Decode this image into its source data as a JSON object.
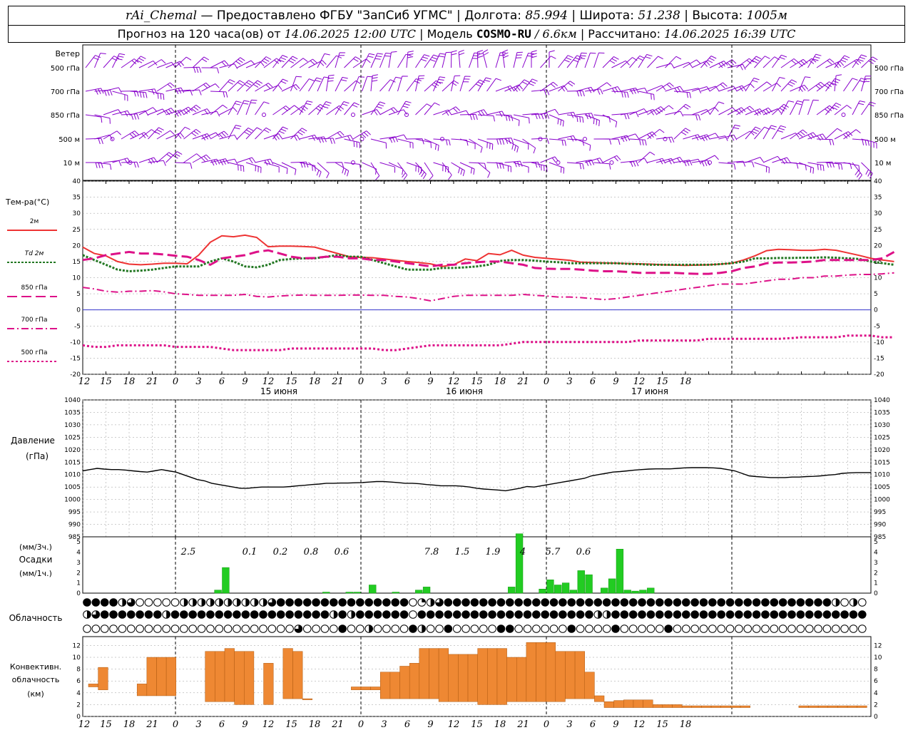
{
  "header": {
    "station": "rAi_Chemal",
    "provider": "Предоставлено ФГБУ \"ЗапСиб УГМС\"",
    "lon_label": "Долгота:",
    "lon": "85.994",
    "lat_label": "Широта:",
    "lat": "51.238",
    "alt_label": "Высота:",
    "alt": "1005м",
    "forecast_prefix": "Прогноз на 120 часа(ов) от",
    "forecast_start": "14.06.2025 12:00 UTC",
    "model_label": "Модель",
    "model_name": "COSMO-RU",
    "model_res": "/ 6.6км",
    "calc_label": "Рассчитано:",
    "calc_time": "14.06.2025 16:39 UTC"
  },
  "colors": {
    "wind": "#8800cc",
    "t2m": "#ee3333",
    "td2m": "#227722",
    "t850": "#dd1188",
    "t700": "#dd1188",
    "t500": "#dd1188",
    "zero_line": "#3333cc",
    "pressure": "#000000",
    "precip": "#22cc22",
    "convective": "#ee8833",
    "grid": "#999999"
  },
  "chart_data": [
    {
      "type": "wind-barbs",
      "title": "Ветер",
      "levels": [
        "500 гПа",
        "700 гПа",
        "850 гПа",
        "500 м",
        "10 м"
      ]
    },
    {
      "type": "line",
      "title": "Тем-ра(°C)",
      "ylim": [
        -20,
        40
      ],
      "yticks": [
        -20,
        -15,
        -10,
        -5,
        0,
        5,
        10,
        15,
        20,
        25,
        30,
        35,
        40
      ],
      "x_tick_labels": [
        "12",
        "15",
        "18",
        "21",
        "0",
        "3",
        "6",
        "9",
        "12",
        "15",
        "18",
        "21",
        "0",
        "3",
        "6",
        "9",
        "12",
        "15",
        "18",
        "21",
        "0",
        "3",
        "6",
        "9",
        "12",
        "15",
        "18"
      ],
      "date_labels": [
        "15 июня",
        "16 июня",
        "17 июня"
      ],
      "series": [
        {
          "name": "2м",
          "values": [
            19.5,
            17.5,
            16.8,
            15,
            14.2,
            14,
            14.2,
            14.5,
            14.5,
            14.3,
            17,
            21,
            23,
            22.7,
            23.2,
            22.5,
            19.6,
            19.8,
            19.8,
            19.7,
            19.5,
            18.5,
            17.5,
            16.5,
            16.3,
            16.2,
            15.8,
            15.4,
            15,
            14.7,
            14.3,
            13.5,
            14,
            15.8,
            15.3,
            17.5,
            17.1,
            18.5,
            17,
            16.3,
            16,
            15.7,
            15.4,
            14.8,
            14.7,
            14.6,
            14.5,
            14.4,
            14.3,
            14.2,
            14,
            13.9,
            13.8,
            13.9,
            14,
            14.2,
            14.5,
            15.5,
            16.8,
            18.4,
            18.8,
            18.7,
            18.5,
            18.5,
            18.8,
            18.5,
            17.7,
            16.9,
            16,
            15.5,
            15
          ]
        },
        {
          "name": "Td 2м",
          "values": [
            17,
            15.5,
            14,
            12.5,
            12,
            12.2,
            12.5,
            13,
            13.5,
            13.5,
            13.5,
            15,
            16,
            15,
            13.5,
            13.2,
            14,
            15.5,
            15.8,
            16,
            16,
            16.5,
            17,
            16.5,
            16.5,
            15.5,
            14.5,
            13.5,
            12.5,
            12.5,
            12.5,
            13,
            13,
            13.2,
            13.5,
            14,
            15.2,
            15.5,
            15.5,
            15.3,
            15,
            14.8,
            14.5,
            14.5,
            14.5,
            14.5,
            14.5,
            14.3,
            14.2,
            14,
            14,
            14,
            14,
            14,
            14,
            14.2,
            14.5,
            15,
            16,
            16,
            16.1,
            16.1,
            16.2,
            16.2,
            16.3,
            16.2,
            16,
            15.8,
            15,
            14.5,
            14
          ]
        },
        {
          "name": "850 гПа",
          "values": [
            15.5,
            16,
            17,
            17.5,
            18,
            17.5,
            17.5,
            17.2,
            16.8,
            16.5,
            15.5,
            14,
            16,
            16.5,
            17,
            18,
            18.5,
            17.5,
            16.5,
            16,
            16.1,
            16.5,
            16.5,
            16,
            16,
            15.5,
            15.5,
            15,
            14.5,
            14,
            13.5,
            14,
            14,
            14.5,
            14.8,
            15,
            15,
            14.5,
            14,
            13,
            12.8,
            12.7,
            12.7,
            12.5,
            12.2,
            12,
            12,
            11.8,
            11.5,
            11.5,
            11.5,
            11.5,
            11.3,
            11.2,
            11.2,
            11.5,
            12,
            13,
            13.5,
            14.5,
            14.7,
            14.7,
            14.8,
            15,
            15.5,
            15.5,
            15.5,
            15.5,
            15.5,
            16,
            18
          ]
        },
        {
          "name": "700 гПа",
          "values": [
            7,
            6.5,
            5.8,
            5.5,
            5.8,
            5.8,
            6,
            5.6,
            5,
            4.8,
            4.5,
            4.5,
            4.5,
            4.5,
            4.8,
            4.2,
            4,
            4.3,
            4.5,
            4.6,
            4.5,
            4.5,
            4.5,
            4.6,
            4.6,
            4.5,
            4.5,
            4.2,
            4,
            3.5,
            2.8,
            3.5,
            4.2,
            4.5,
            4.5,
            4.5,
            4.5,
            4.5,
            4.8,
            4.5,
            4.3,
            4,
            4,
            3.8,
            3.5,
            3.2,
            3.5,
            4,
            4.5,
            5,
            5.5,
            6,
            6.5,
            7,
            7.5,
            8,
            8,
            8,
            8.5,
            9,
            9.5,
            9.5,
            10,
            10,
            10.5,
            10.5,
            10.8,
            11,
            11,
            11.2,
            11.5
          ]
        },
        {
          "name": "500 гПа",
          "values": [
            -11,
            -11.5,
            -11.5,
            -11,
            -11,
            -11,
            -11,
            -11,
            -11.5,
            -11.5,
            -11.5,
            -11.5,
            -12,
            -12.5,
            -12.5,
            -12.5,
            -12.5,
            -12.5,
            -12,
            -12,
            -12,
            -12,
            -12,
            -12,
            -12,
            -12,
            -12.5,
            -12.5,
            -12,
            -11.5,
            -11,
            -11,
            -11,
            -11,
            -11,
            -11,
            -11,
            -10.5,
            -10,
            -10,
            -10,
            -10,
            -10,
            -10,
            -10,
            -10,
            -10,
            -10,
            -9.5,
            -9.5,
            -9.5,
            -9.5,
            -9.5,
            -9.5,
            -9,
            -9,
            -9,
            -9,
            -9,
            -9,
            -9,
            -8.8,
            -8.5,
            -8.5,
            -8.5,
            -8.5,
            -8,
            -8,
            -8,
            -8.5,
            -8.5
          ]
        }
      ]
    },
    {
      "type": "line",
      "title": "Давление",
      "unit": "(гПа)",
      "ylim": [
        985,
        1040
      ],
      "yticks": [
        985,
        990,
        995,
        1000,
        1005,
        1010,
        1015,
        1020,
        1025,
        1030,
        1035,
        1040
      ],
      "series": [
        {
          "name": "Давление",
          "values": [
            1011.5,
            1012,
            1012.5,
            1012.2,
            1012,
            1012,
            1011.8,
            1011.5,
            1011.2,
            1011,
            1011.5,
            1012,
            1011.5,
            1011,
            1010,
            1009,
            1008,
            1007.5,
            1006.5,
            1006,
            1005.5,
            1005,
            1004.5,
            1004.5,
            1004.8,
            1005,
            1005,
            1005,
            1005,
            1005.2,
            1005.5,
            1005.7,
            1006,
            1006.2,
            1006.5,
            1006.5,
            1006.6,
            1006.6,
            1006.7,
            1006.8,
            1007,
            1007.2,
            1007.2,
            1007,
            1006.8,
            1006.5,
            1006.5,
            1006.3,
            1006,
            1005.8,
            1005.5,
            1005.5,
            1005.5,
            1005.3,
            1005,
            1004.5,
            1004.2,
            1004,
            1003.8,
            1003.5,
            1004,
            1004.5,
            1005.2,
            1005,
            1005.5,
            1006,
            1006.5,
            1007,
            1007.5,
            1008,
            1008.5,
            1009.5,
            1010,
            1010.5,
            1011,
            1011.2,
            1011.5,
            1011.8,
            1012,
            1012.2,
            1012.3,
            1012.3,
            1012.3,
            1012.5,
            1012.7,
            1012.8,
            1012.8,
            1012.8,
            1012.7,
            1012.5,
            1012,
            1011.5,
            1010.5,
            1009.5,
            1009.2,
            1009,
            1008.8,
            1008.8,
            1008.8,
            1009,
            1009,
            1009.2,
            1009.3,
            1009.5,
            1009.8,
            1010,
            1010.5,
            1010.7,
            1010.8,
            1010.8,
            1010.8
          ]
        }
      ]
    },
    {
      "type": "bar",
      "title": "Осадки",
      "unit_3h": "(мм/3ч.)",
      "unit_1h": "(мм/1ч.)",
      "ylim": [
        0,
        6
      ],
      "yticks": [
        0,
        1,
        2,
        3,
        4,
        5
      ],
      "values": [
        0,
        0,
        0,
        0,
        0,
        0,
        0,
        0,
        0,
        0,
        0,
        0,
        0,
        0,
        0,
        0,
        0,
        0.3,
        2.5,
        0,
        0,
        0,
        0,
        0,
        0,
        0,
        0,
        0,
        0,
        0,
        0,
        0.1,
        0,
        0,
        0.1,
        0.1,
        0,
        0.8,
        0,
        0,
        0.1,
        0,
        0,
        0.3,
        0.6,
        0,
        0,
        0,
        0,
        0,
        0,
        0,
        0,
        0,
        0,
        0.6,
        6,
        0,
        0,
        0.4,
        1.3,
        0.8,
        1,
        0.3,
        2.2,
        1.8,
        0,
        0.5,
        1.4,
        4.3,
        0.3,
        0.2,
        0.3,
        0.5,
        0,
        0,
        0,
        0,
        0,
        0,
        0
      ],
      "totals": [
        "2.5",
        "0.1",
        "0.2",
        "0.8",
        "0.6",
        "7.8",
        "1.5",
        "1.9",
        "4",
        "5.7",
        "0.6"
      ]
    },
    {
      "type": "table",
      "title": "Облачность",
      "rows": [
        "444423000002222222222344444444444444401234444444444444444444444444444444444444444444420200000000310000000000000000000002",
        "234444444244444444444444444424244444404444444444444444444422444444444444444444444444444440000000000000000000000000000000",
        "000000000000000000000000300004002000042004000004400000040000400000400000000000000000000000000000000000000000002000000003"
      ]
    },
    {
      "type": "bar",
      "title": "Конвективн. облачность",
      "unit": "(км)",
      "ylim": [
        0,
        13
      ],
      "yticks": [
        0,
        2,
        4,
        6,
        8,
        10,
        12
      ],
      "values": [
        [
          5,
          5.5
        ],
        [
          4.5,
          8.3
        ],
        [
          0,
          0
        ],
        [
          0,
          0
        ],
        [
          0,
          0
        ],
        [
          3.5,
          5.5
        ],
        [
          3.5,
          10
        ],
        [
          3.5,
          10
        ],
        [
          3.5,
          10
        ],
        [
          0,
          0
        ],
        [
          0,
          0
        ],
        [
          0,
          0
        ],
        [
          2.5,
          11
        ],
        [
          2.5,
          11
        ],
        [
          2.5,
          11.5
        ],
        [
          2,
          11
        ],
        [
          2,
          11
        ],
        [
          0,
          0
        ],
        [
          2,
          9
        ],
        [
          0,
          0
        ],
        [
          3,
          11.5
        ],
        [
          3,
          11
        ],
        [
          3,
          3
        ],
        [
          0,
          0
        ],
        [
          0,
          0
        ],
        [
          0,
          0
        ],
        [
          0,
          0
        ],
        [
          4.5,
          5
        ],
        [
          4.5,
          5
        ],
        [
          4.5,
          5
        ],
        [
          3,
          7.5
        ],
        [
          3,
          7.5
        ],
        [
          3,
          8.5
        ],
        [
          3,
          9
        ],
        [
          3,
          11.5
        ],
        [
          3,
          11.5
        ],
        [
          2.5,
          11.5
        ],
        [
          2.5,
          10.5
        ],
        [
          2.5,
          10.5
        ],
        [
          2.5,
          10.5
        ],
        [
          2,
          11.5
        ],
        [
          2,
          11.5
        ],
        [
          2,
          11.5
        ],
        [
          2.5,
          10
        ],
        [
          2.5,
          10
        ],
        [
          2.5,
          12.5
        ],
        [
          2.5,
          12.5
        ],
        [
          2.5,
          12.5
        ],
        [
          2.5,
          11
        ],
        [
          3,
          11
        ],
        [
          3,
          11
        ],
        [
          3,
          7.5
        ],
        [
          2.5,
          3.5
        ],
        [
          1.5,
          2.5
        ],
        [
          1.5,
          2.7
        ],
        [
          1.5,
          2.8
        ],
        [
          1.5,
          2.8
        ],
        [
          1.5,
          2.8
        ],
        [
          1.5,
          2
        ],
        [
          1.5,
          2
        ],
        [
          1.5,
          2
        ],
        [
          1.5,
          1.8
        ],
        [
          1.5,
          1.8
        ],
        [
          1.5,
          1.8
        ],
        [
          1.5,
          1.8
        ],
        [
          1.5,
          1.8
        ],
        [
          1.5,
          1.8
        ],
        [
          1.5,
          1.8
        ],
        [
          0,
          0
        ],
        [
          0,
          0
        ],
        [
          0,
          0
        ],
        [
          0,
          0
        ],
        [
          0,
          0
        ],
        [
          1.5,
          1.8
        ],
        [
          1.5,
          1.8
        ],
        [
          1.5,
          1.8
        ],
        [
          1.5,
          1.8
        ],
        [
          1.5,
          1.8
        ],
        [
          1.5,
          1.8
        ],
        [
          1.5,
          1.8
        ],
        [
          0,
          0
        ]
      ]
    }
  ],
  "legend": {
    "t2m": "2м",
    "td2m_a": "Td",
    "td2m_b": "2м",
    "t850": "850 гПа",
    "t700": "700 гПа",
    "t500": "500 гПа"
  }
}
